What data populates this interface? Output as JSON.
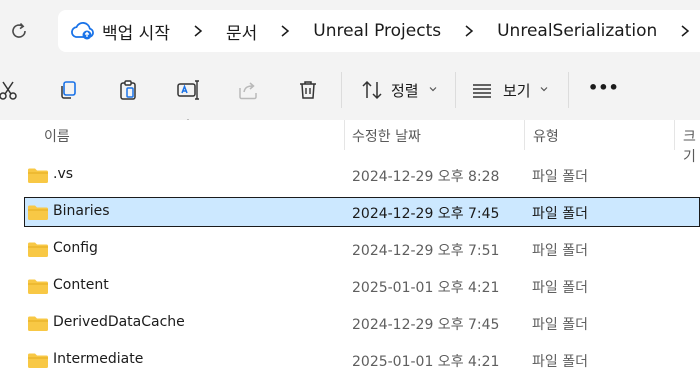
{
  "breadcrumbs": [
    "백업 시작",
    "문서",
    "Unreal Projects",
    "UnrealSerialization"
  ],
  "toolbar": {
    "sort_label": "정렬",
    "view_label": "보기",
    "more_label": "•••"
  },
  "columns": {
    "name": "이름",
    "date": "수정한 날짜",
    "type": "유형",
    "size": "크기"
  },
  "files": [
    {
      "name": ".vs",
      "date": "2024-12-29 오후 8:28",
      "type": "파일 폴더"
    },
    {
      "name": "Binaries",
      "date": "2024-12-29 오후 7:45",
      "type": "파일 폴더"
    },
    {
      "name": "Config",
      "date": "2024-12-29 오후 7:51",
      "type": "파일 폴더"
    },
    {
      "name": "Content",
      "date": "2025-01-01 오후 4:21",
      "type": "파일 폴더"
    },
    {
      "name": "DerivedDataCache",
      "date": "2024-12-29 오후 7:45",
      "type": "파일 폴더"
    },
    {
      "name": "Intermediate",
      "date": "2025-01-01 오후 4:21",
      "type": "파일 폴더"
    }
  ],
  "icons": {
    "refresh": "refresh-icon",
    "cloud": "cloud-backup-icon",
    "cut": "cut-icon",
    "copy": "copy-icon",
    "paste": "paste-icon",
    "rename": "rename-icon",
    "share": "share-icon",
    "delete": "delete-icon",
    "sort": "sort-icon",
    "view": "view-icon",
    "folder": "folder-icon"
  },
  "colors": {
    "chrome_bg": "#f3f3f3",
    "selection_bg": "#cce8ff",
    "folder_yellow": "#f8c845",
    "cloud_blue": "#1a73e8"
  }
}
